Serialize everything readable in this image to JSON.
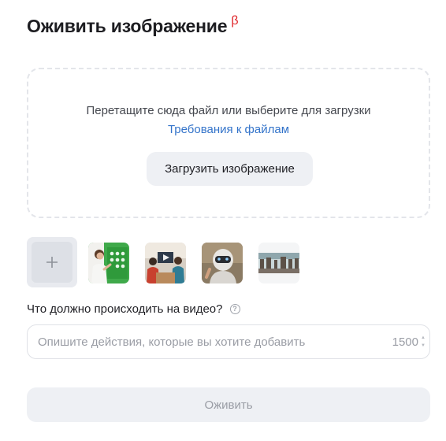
{
  "header": {
    "title": "Оживить изображение",
    "badge": "β",
    "badge_color": "#e0262b"
  },
  "dropzone": {
    "hint": "Перетащите сюда файл или выберите для загрузки",
    "requirements_link": "Требования к файлам",
    "upload_button": "Загрузить изображение"
  },
  "thumbnails": {
    "add_icon": "plus-icon",
    "items": [
      {
        "name": "example-thumb-teacher-green-board"
      },
      {
        "name": "example-thumb-meeting-screen"
      },
      {
        "name": "example-thumb-robot"
      },
      {
        "name": "example-thumb-city-street"
      }
    ]
  },
  "prompt": {
    "question": "Что должно происходить на видео?",
    "help_icon": "question-circle-icon",
    "placeholder": "Опишите действия, которые вы хотите добавить",
    "value": "",
    "counter": "1500"
  },
  "submit": {
    "label": "Оживить",
    "state": "disabled"
  },
  "colors": {
    "accent_link": "#3474ca",
    "button_bg": "#eef0f4",
    "disabled_text": "#9a9da5"
  }
}
